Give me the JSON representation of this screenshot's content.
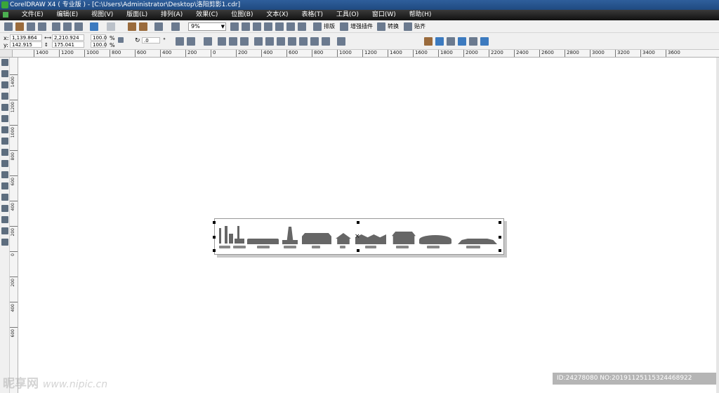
{
  "window": {
    "title": "CorelDRAW X4 ( 专业版 ) - [C:\\Users\\Administrator\\Desktop\\洛阳剪影1.cdr]"
  },
  "menu": [
    "文件(E)",
    "编辑(E)",
    "视图(V)",
    "版面(L)",
    "排列(A)",
    "效果(C)",
    "位图(B)",
    "文本(X)",
    "表格(T)",
    "工具(O)",
    "窗口(W)",
    "帮助(H)"
  ],
  "toolbar": {
    "zoom": "9%",
    "paiban": "排版",
    "zengqiang": "增强插件",
    "zhuanhuan": "转换",
    "tieqi": "贴齐"
  },
  "properties": {
    "x_label": "x:",
    "x": "1,139.864 mm",
    "y_label": "y:",
    "y": "142.915 mm",
    "width": "2,210.924 mm",
    "height": "175.041 mm",
    "scale_x": "100.0",
    "scale_y": "100.0",
    "pct1": "%",
    "pct2": "%",
    "rotation": ".0",
    "deg": "°"
  },
  "hruler": {
    "labels": [
      "1400",
      "1200",
      "1000",
      "800",
      "600",
      "400",
      "200",
      "0",
      "200",
      "400",
      "600",
      "800",
      "1000",
      "1200",
      "1400",
      "1600",
      "1800",
      "2000",
      "2200",
      "2400",
      "2600",
      "2800",
      "3000",
      "3200",
      "3400",
      "3600"
    ]
  },
  "vruler": {
    "labels": [
      "1400",
      "1200",
      "1000",
      "800",
      "600",
      "400",
      "200",
      "0",
      "200",
      "400",
      "600"
    ]
  },
  "watermark": {
    "logo": "昵享网",
    "url": "www.nipic.cn",
    "id": "ID:24278080 NO:20191125115324468922"
  },
  "colors": {
    "title_bar": "#1f4a80",
    "menu_bar": "#111111",
    "silhouette": "#666666"
  }
}
